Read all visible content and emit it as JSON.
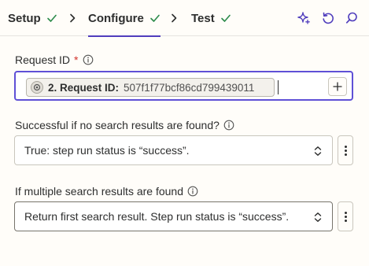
{
  "steps": [
    {
      "label": "Setup",
      "status": "complete"
    },
    {
      "label": "Configure",
      "status": "complete",
      "active": true
    },
    {
      "label": "Test",
      "status": "complete"
    }
  ],
  "toolbar_icons": [
    "sparkle-icon",
    "refresh-icon",
    "search-icon"
  ],
  "fields": {
    "request_id": {
      "label": "Request ID",
      "required_mark": "*",
      "mapped_step": "2. Request ID:",
      "mapped_value": "507f1f77bcf86cd799439011"
    },
    "no_results": {
      "label": "Successful if no search results are found?",
      "value": "True: step run status is “success”."
    },
    "multiple_results": {
      "label": "If multiple search results are found",
      "value": "Return first search result. Step run status is “success”."
    }
  },
  "colors": {
    "accent": "#503ebd",
    "check": "#2b8a4a",
    "required": "#d2332b"
  }
}
